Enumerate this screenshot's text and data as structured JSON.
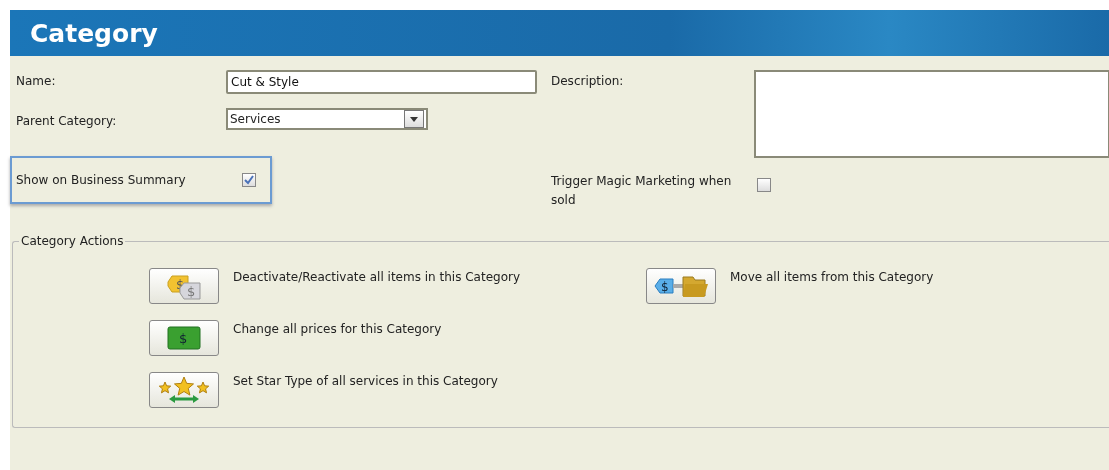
{
  "header": {
    "title": "Category"
  },
  "name": {
    "label": "Name:",
    "value": "Cut & Style"
  },
  "parent_category": {
    "label": "Parent Category:",
    "value": "Services"
  },
  "description": {
    "label": "Description:"
  },
  "show_on_summary": {
    "label": "Show on Business Summary",
    "checked": true,
    "highlighted": true
  },
  "trigger_marketing": {
    "label": "Trigger Magic Marketing when sold",
    "checked": false
  },
  "actions": {
    "legend": "Category Actions",
    "items": [
      {
        "kind": "tags",
        "glyph": "$",
        "label": "Deactivate/Reactivate all items in this Category"
      },
      {
        "kind": "money",
        "glyph": "$",
        "label": "Change all prices for this Category"
      },
      {
        "kind": "stars",
        "label": "Set Star Type of all services in this Category"
      },
      {
        "kind": "move",
        "glyph": "$",
        "label": "Move all items from this Category"
      }
    ]
  }
}
